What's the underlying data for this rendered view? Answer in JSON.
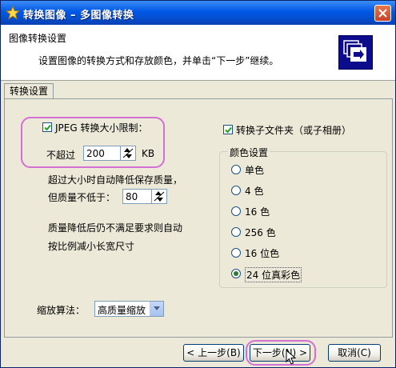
{
  "window": {
    "title": "转换图像 – 多图像转换"
  },
  "header": {
    "title": "图像转换设置",
    "description": "设置图像的转换方式和存放颜色，并单击“下一步”继续。"
  },
  "tabs": [
    {
      "label": "转换设置"
    }
  ],
  "jpeg": {
    "checkbox_label": "JPEG 转换大小限制：",
    "checked": true,
    "max_label": "不超过",
    "max_value": "200",
    "unit": "KB",
    "auto_lower_note": "超过大小时自动降低保存质量，",
    "quality_label": "但质量不低于：",
    "quality_value": "80",
    "fallback_note_1": "质量降低后仍不满足要求则自动",
    "fallback_note_2": "按比例减小长宽尺寸"
  },
  "subfolder": {
    "label": "转换子文件夹（或子相册）",
    "checked": true
  },
  "color_settings": {
    "title": "颜色设置",
    "options": [
      {
        "label": "单色",
        "selected": false
      },
      {
        "label": "4 色",
        "selected": false
      },
      {
        "label": "16 色",
        "selected": false
      },
      {
        "label": "256 色",
        "selected": false
      },
      {
        "label": "16 位色",
        "selected": false
      },
      {
        "label": "24 位真彩色",
        "selected": true
      }
    ]
  },
  "scaling": {
    "label": "缩放算法：",
    "selected": "高质量缩放"
  },
  "buttons": {
    "back": "< 上一步(B)",
    "next": "下一步(N) >",
    "cancel": "取消(C)"
  },
  "colors": {
    "title_bar": "#0058e6",
    "highlight": "#d46fd4",
    "dialog_bg": "#ece9d8"
  }
}
